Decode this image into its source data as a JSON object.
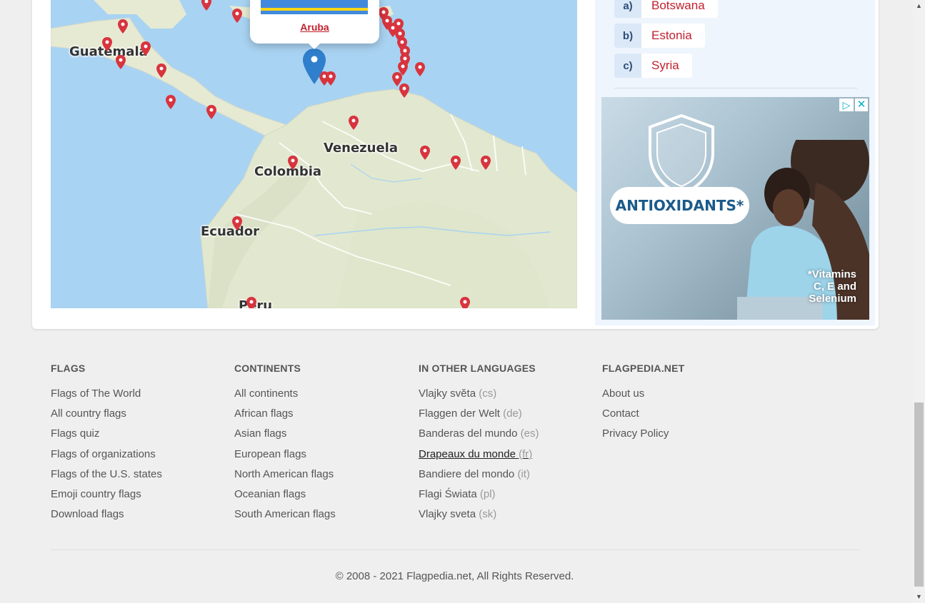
{
  "map": {
    "labels": {
      "guatemala": "Guatemala",
      "venezuela": "Venezuela",
      "colombia": "Colombia",
      "ecuador": "Ecuador",
      "peru": "Peru"
    },
    "popup": {
      "country": "Aruba"
    }
  },
  "quiz": {
    "options": [
      {
        "letter": "a)",
        "answer": "Botswana"
      },
      {
        "letter": "b)",
        "answer": "Estonia"
      },
      {
        "letter": "c)",
        "answer": "Syria"
      }
    ]
  },
  "ad": {
    "headline": "ANTIOXIDANTS*",
    "footnote_line1": "*Vitamins",
    "footnote_line2": "C, E and",
    "footnote_line3": "Selenium",
    "adchoices_icon": "adchoices-icon",
    "close_icon": "close-icon"
  },
  "footer": {
    "flags": {
      "title": "FLAGS",
      "links": [
        "Flags of The World",
        "All country flags",
        "Flags quiz",
        "Flags of organizations",
        "Flags of the U.S. states",
        "Emoji country flags",
        "Download flags"
      ]
    },
    "continents": {
      "title": "CONTINENTS",
      "links": [
        "All continents",
        "African flags",
        "Asian flags",
        "European flags",
        "North American flags",
        "Oceanian flags",
        "South American flags"
      ]
    },
    "languages": {
      "title": "IN OTHER LANGUAGES",
      "links": [
        {
          "label": "Vlajky světa",
          "code": "(cs)"
        },
        {
          "label": "Flaggen der Welt",
          "code": "(de)"
        },
        {
          "label": "Banderas del mundo",
          "code": "(es)"
        },
        {
          "label": "Drapeaux du monde",
          "code": "(fr)"
        },
        {
          "label": "Bandiere del mondo",
          "code": "(it)"
        },
        {
          "label": "Flagi Świata",
          "code": "(pl)"
        },
        {
          "label": "Vlajky sveta",
          "code": "(sk)"
        }
      ]
    },
    "site": {
      "title": "FLAGPEDIA.NET",
      "links": [
        "About us",
        "Contact",
        "Privacy Policy"
      ]
    },
    "copyright": "© 2008 - 2021 Flagpedia.net, All Rights Reserved."
  },
  "colors": {
    "accent_red": "#c2202e",
    "map_water": "#a9d3f2",
    "map_land": "#e8ecd9",
    "quiz_bg": "#eef5fd",
    "pin_blue": "#2f7fcc",
    "pin_red": "#d8343e"
  }
}
